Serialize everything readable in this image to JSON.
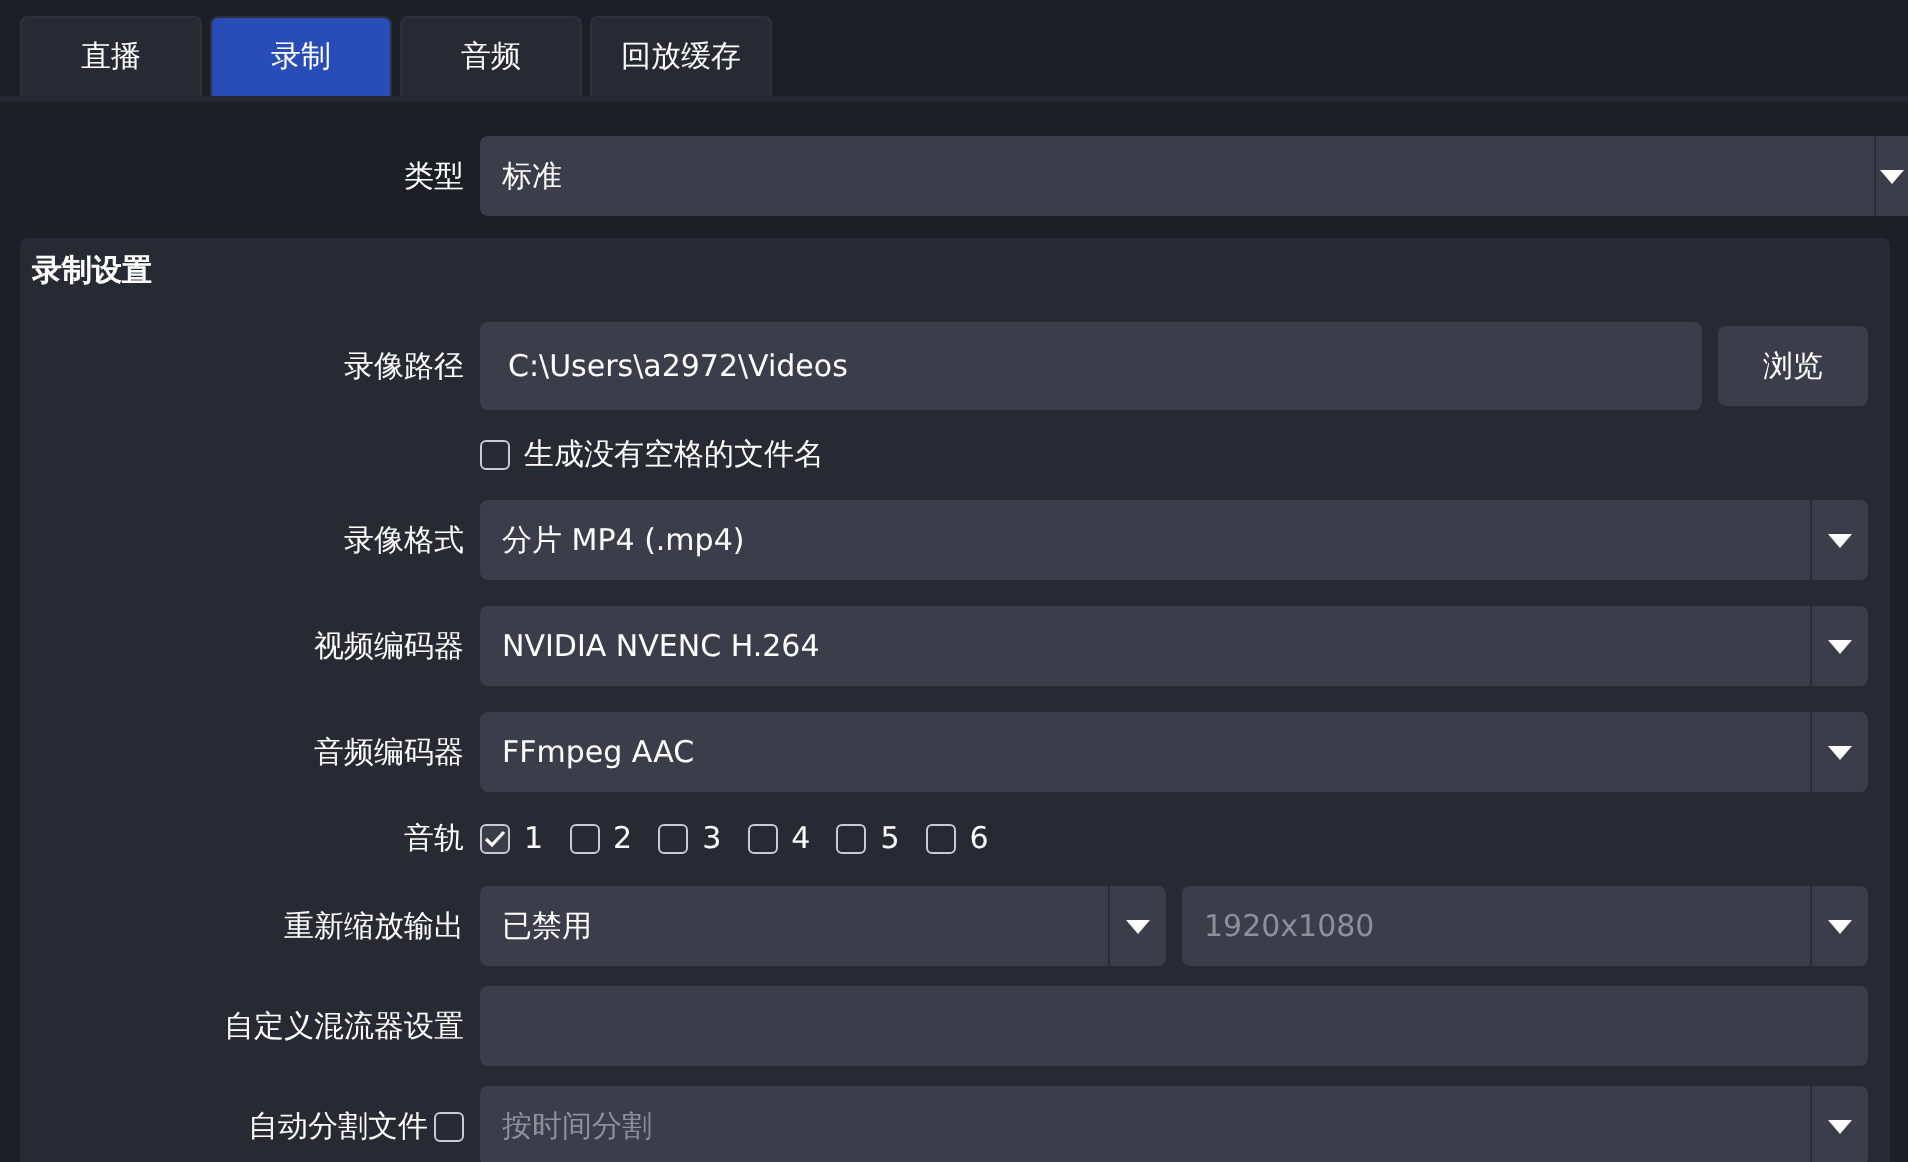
{
  "tabs": [
    {
      "label": "直播",
      "selected": false
    },
    {
      "label": "录制",
      "selected": true
    },
    {
      "label": "音频",
      "selected": false
    },
    {
      "label": "回放缓存",
      "selected": false
    }
  ],
  "type": {
    "label": "类型",
    "value": "标准"
  },
  "recording_settings": {
    "title": "录制设置",
    "rows": [
      {
        "kind": "path",
        "label": "录像路径",
        "value": "C:\\Users\\a2972\\Videos",
        "button": "浏览"
      },
      {
        "kind": "checkbox",
        "label": "生成没有空格的文件名",
        "checked": false
      },
      {
        "kind": "select",
        "label": "录像格式",
        "value": "分片 MP4 (.mp4)"
      },
      {
        "kind": "select",
        "label": "视频编码器",
        "value": "NVIDIA NVENC H.264"
      },
      {
        "kind": "select",
        "label": "音频编码器",
        "value": "FFmpeg AAC"
      },
      {
        "kind": "tracks",
        "label": "音轨",
        "tracks": [
          {
            "label": "1",
            "checked": true
          },
          {
            "label": "2",
            "checked": false
          },
          {
            "label": "3",
            "checked": false
          },
          {
            "label": "4",
            "checked": false
          },
          {
            "label": "5",
            "checked": false
          },
          {
            "label": "6",
            "checked": false
          }
        ]
      },
      {
        "kind": "rescale",
        "label": "重新缩放输出",
        "selects": [
          {
            "value": "已禁用",
            "disabled": false
          },
          {
            "value": "1920x1080",
            "disabled": true
          }
        ]
      },
      {
        "kind": "input",
        "label": "自定义混流器设置"
      },
      {
        "kind": "split",
        "label": "自动分割文件",
        "checked": false,
        "value": "按时间分割",
        "disabled": true
      }
    ]
  }
}
